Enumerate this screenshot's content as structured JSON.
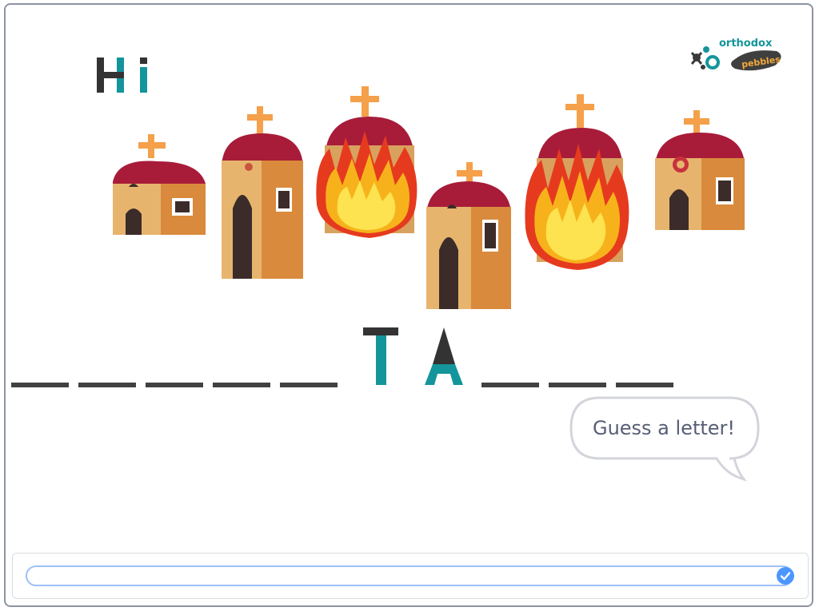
{
  "greeting": {
    "letters": [
      "H",
      "i"
    ]
  },
  "logo": {
    "word1": "orthodox",
    "word2": "pebbles"
  },
  "word": {
    "slots": [
      "",
      "",
      "",
      "",
      "",
      "T",
      "A",
      "",
      "",
      ""
    ]
  },
  "bubble": {
    "text": "Guess a letter!"
  },
  "answer": {
    "value": "",
    "placeholder": ""
  },
  "colors": {
    "teal": "#13959b",
    "dark": "#333333",
    "dash": "#414141",
    "submit": "#4c97ff",
    "input_border": "#9ec1f7"
  },
  "icons": {
    "submit": "check-circle-icon",
    "cross": "cross-icon",
    "flame": "flame-icon"
  }
}
